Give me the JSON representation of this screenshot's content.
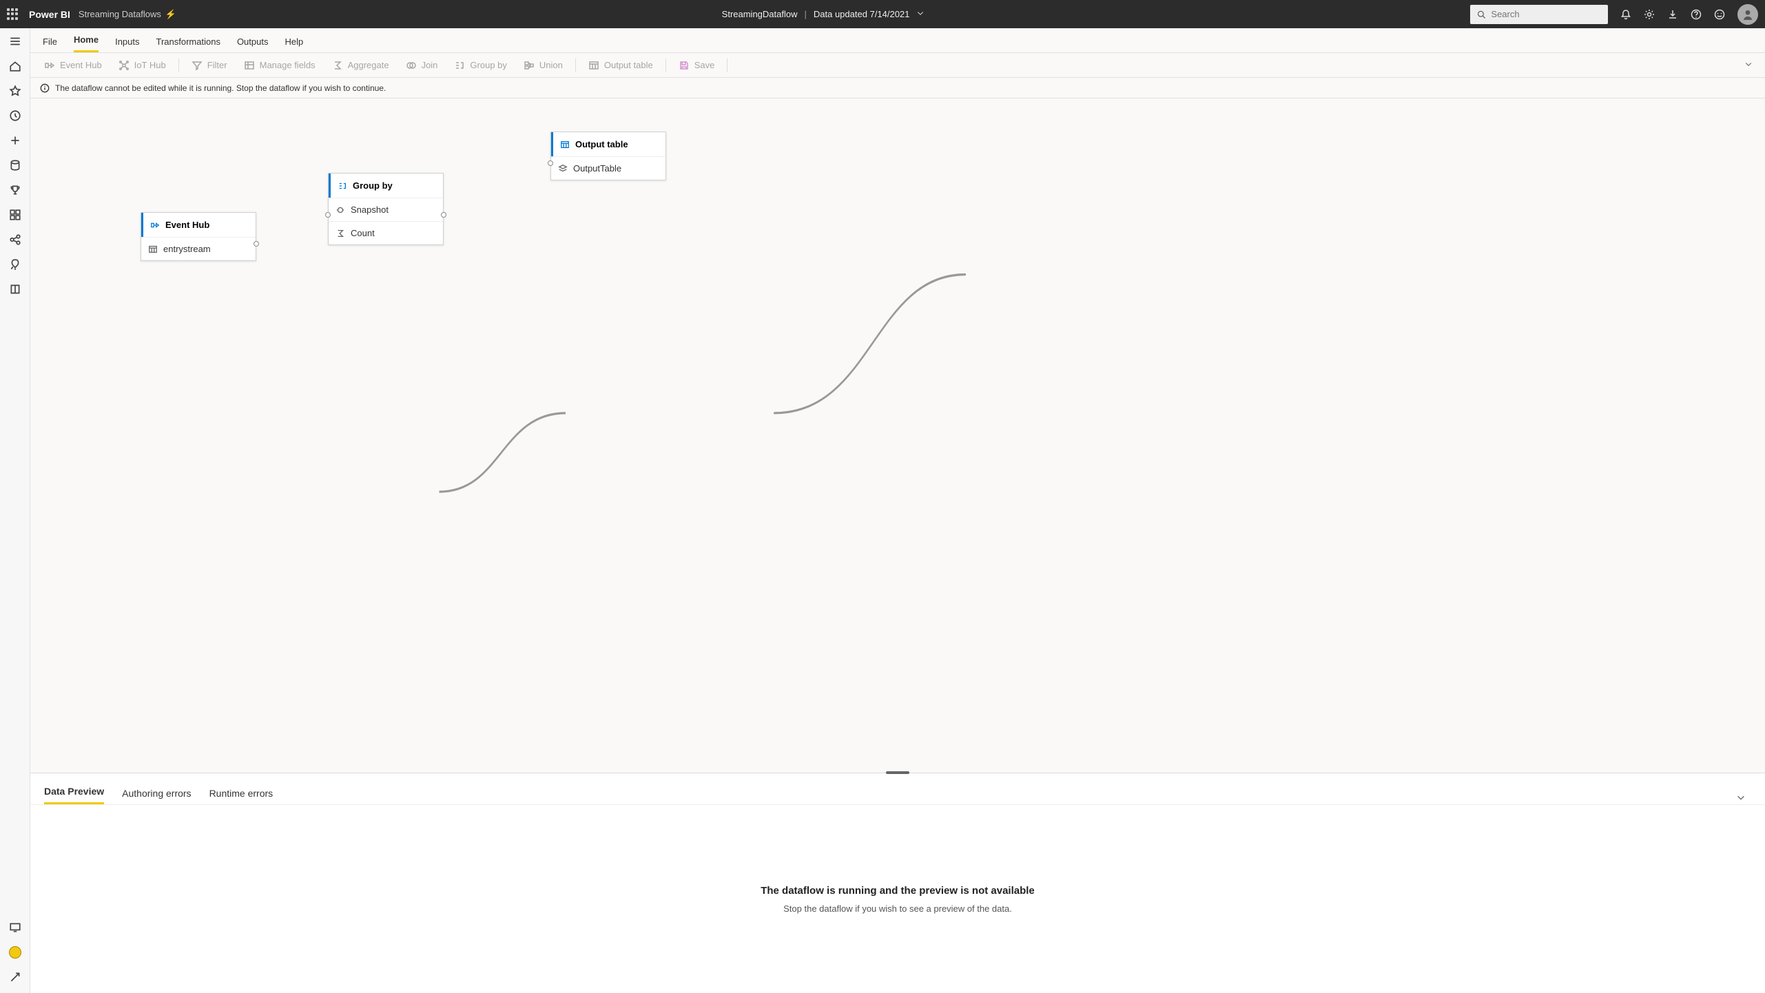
{
  "header": {
    "app": "Power BI",
    "workspace": "Streaming Dataflows",
    "dataflow_name": "StreamingDataflow",
    "updated_text": "Data updated 7/14/2021",
    "search_placeholder": "Search"
  },
  "tabs": {
    "file": "File",
    "home": "Home",
    "inputs": "Inputs",
    "transformations": "Transformations",
    "outputs": "Outputs",
    "help": "Help",
    "active": "Home"
  },
  "ribbon": {
    "event_hub": "Event Hub",
    "iot_hub": "IoT Hub",
    "filter": "Filter",
    "manage_fields": "Manage fields",
    "aggregate": "Aggregate",
    "join": "Join",
    "group_by": "Group by",
    "union": "Union",
    "output_table": "Output table",
    "save": "Save"
  },
  "infobar": {
    "text": "The dataflow cannot be edited while it is running. Stop the dataflow if you wish to continue."
  },
  "nodes": {
    "event_hub": {
      "title": "Event Hub",
      "row1": "entrystream"
    },
    "group_by": {
      "title": "Group by",
      "row1": "Snapshot",
      "row2": "Count"
    },
    "output_table": {
      "title": "Output table",
      "row1": "OutputTable"
    }
  },
  "bottom_panel": {
    "tab_preview": "Data Preview",
    "tab_authoring": "Authoring errors",
    "tab_runtime": "Runtime errors",
    "active": "Data Preview",
    "message_title": "The dataflow is running and the preview is not available",
    "message_sub": "Stop the dataflow if you wish to see a preview of the data."
  }
}
